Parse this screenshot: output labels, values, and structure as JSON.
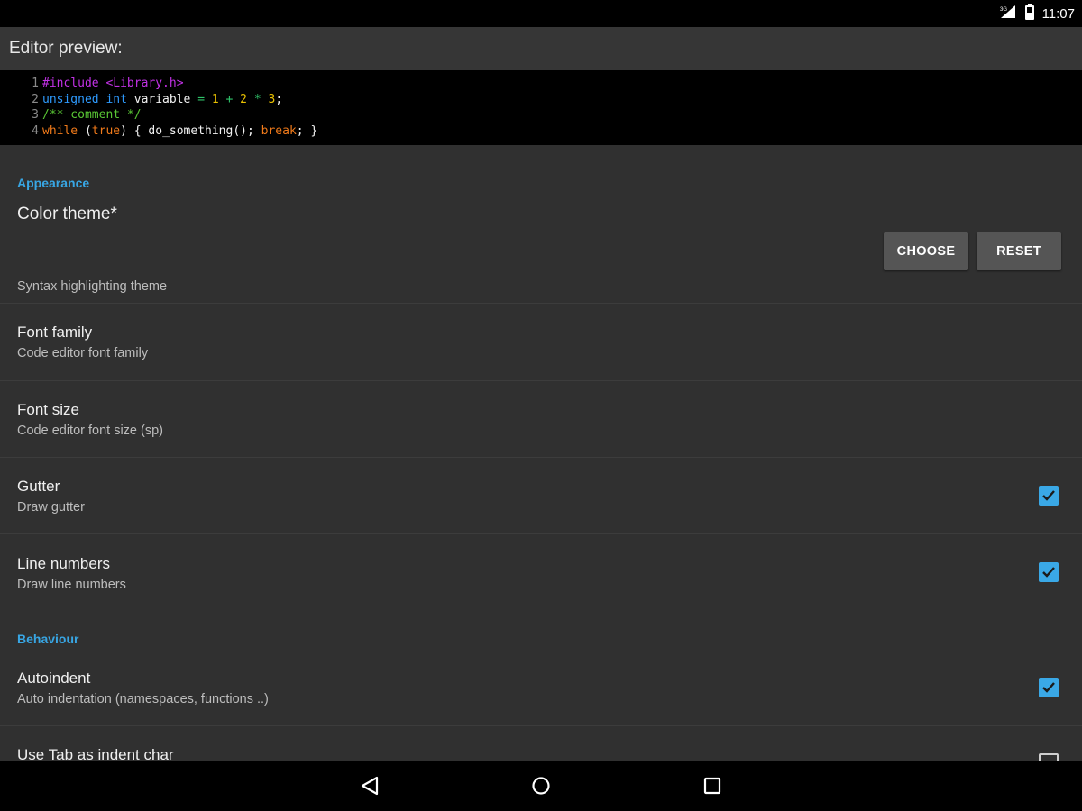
{
  "status_bar": {
    "time": "11:07",
    "icons": [
      "signal-icon",
      "battery-icon"
    ]
  },
  "title_bar": {
    "title": "Editor preview:"
  },
  "editor": {
    "lines": [
      {
        "number": "1",
        "tokens": [
          {
            "type": "pre",
            "text": "#include <Library.h>"
          }
        ]
      },
      {
        "number": "2",
        "tokens": [
          {
            "type": "kw",
            "text": "unsigned int"
          },
          {
            "type": "plain",
            "text": " variable "
          },
          {
            "type": "op",
            "text": "="
          },
          {
            "type": "plain",
            "text": " "
          },
          {
            "type": "num",
            "text": "1"
          },
          {
            "type": "plain",
            "text": " "
          },
          {
            "type": "op",
            "text": "+"
          },
          {
            "type": "plain",
            "text": " "
          },
          {
            "type": "num",
            "text": "2"
          },
          {
            "type": "plain",
            "text": " "
          },
          {
            "type": "op",
            "text": "*"
          },
          {
            "type": "plain",
            "text": " "
          },
          {
            "type": "num",
            "text": "3"
          },
          {
            "type": "plain",
            "text": ";"
          }
        ]
      },
      {
        "number": "3",
        "tokens": [
          {
            "type": "com",
            "text": "/** comment */"
          }
        ]
      },
      {
        "number": "4",
        "tokens": [
          {
            "type": "ctl",
            "text": "while"
          },
          {
            "type": "plain",
            "text": " ("
          },
          {
            "type": "ctl",
            "text": "true"
          },
          {
            "type": "plain",
            "text": ") { do_something(); "
          },
          {
            "type": "ctl",
            "text": "break"
          },
          {
            "type": "plain",
            "text": "; }"
          }
        ]
      }
    ]
  },
  "settings": {
    "appearance_header": "Appearance",
    "color_theme": {
      "title": "Color theme*",
      "summary": "Syntax highlighting theme",
      "choose_label": "CHOOSE",
      "reset_label": "RESET"
    },
    "font_family": {
      "title": "Font family",
      "summary": "Code editor font family"
    },
    "font_size": {
      "title": "Font size",
      "summary": "Code editor font size (sp)"
    },
    "gutter": {
      "title": "Gutter",
      "summary": "Draw gutter",
      "checked": true
    },
    "line_numbers": {
      "title": "Line numbers",
      "summary": "Draw line numbers",
      "checked": true
    },
    "behaviour_header": "Behaviour",
    "autoindent": {
      "title": "Autoindent",
      "summary": "Auto indentation (namespaces, functions ..)",
      "checked": true
    },
    "use_tab": {
      "title": "Use Tab as indent char",
      "checked": false
    }
  },
  "nav_bar": {
    "buttons": [
      "back-icon",
      "home-icon",
      "recents-icon"
    ]
  },
  "colors": {
    "accent": "#38a6e4",
    "background": "#303030",
    "title_bar": "#363636",
    "editor_bg": "#000000"
  }
}
